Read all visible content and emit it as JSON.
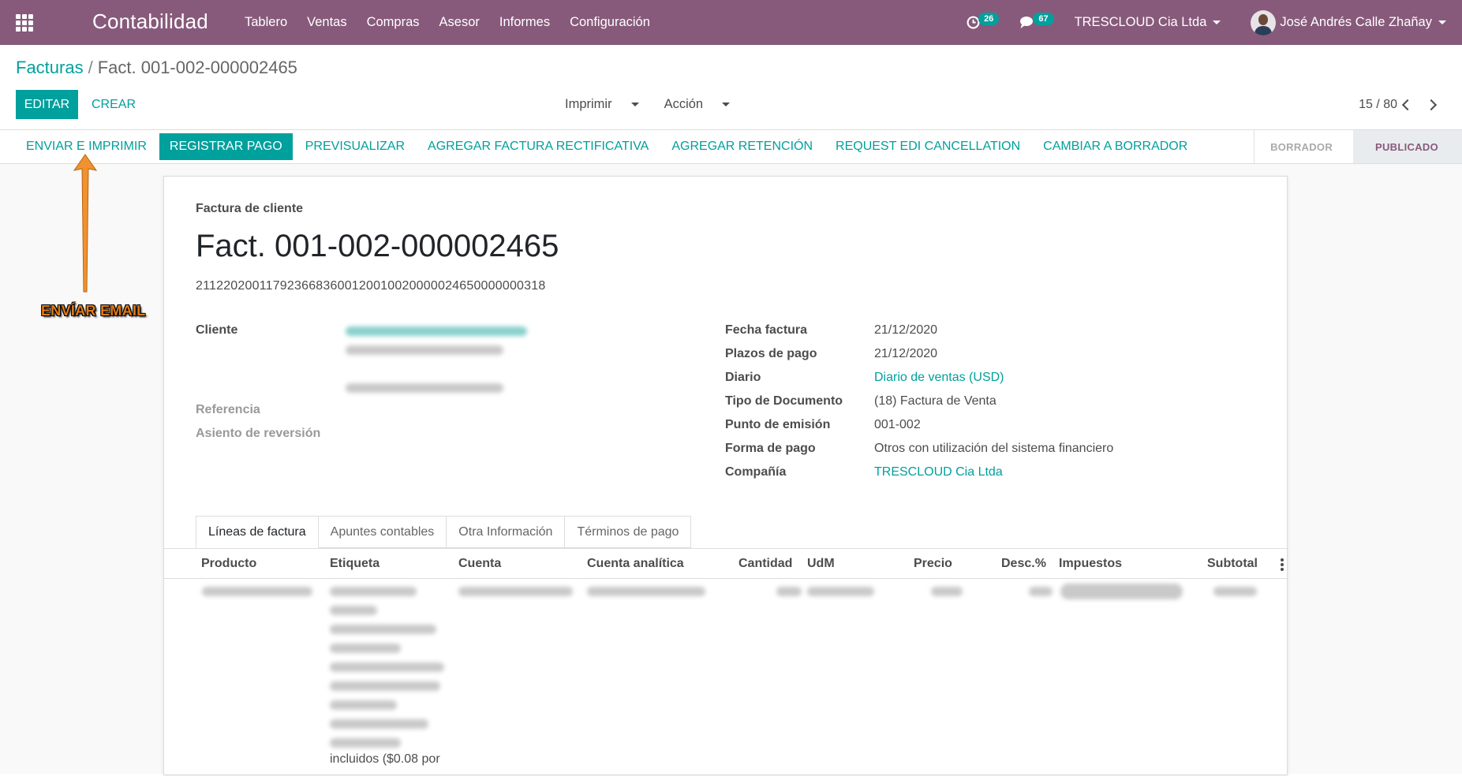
{
  "navbar": {
    "app_title": "Contabilidad",
    "menu": [
      "Tablero",
      "Ventas",
      "Compras",
      "Asesor",
      "Informes",
      "Configuración"
    ],
    "activity_count": "26",
    "messages_count": "67",
    "company": "TRESCLOUD Cia Ltda",
    "user": "José Andrés Calle Zhañay"
  },
  "control": {
    "breadcrumb_parent": "Facturas",
    "breadcrumb_separator": "/",
    "breadcrumb_current": "Fact. 001-002-000002465",
    "edit_label": "EDITAR",
    "create_label": "CREAR",
    "print_label": "Imprimir",
    "action_label": "Acción",
    "pager": "15 / 80"
  },
  "statusbar": {
    "buttons": [
      "ENVIAR E IMPRIMIR",
      "REGISTRAR PAGO",
      "PREVISUALIZAR",
      "AGREGAR FACTURA RECTIFICATIVA",
      "AGREGAR RETENCIÓN",
      "REQUEST EDI CANCELLATION",
      "CAMBIAR A BORRADOR"
    ],
    "stages": [
      "BORRADOR",
      "PUBLICADO"
    ],
    "active_stage": "PUBLICADO"
  },
  "annotation": {
    "label": "ENVÍAR EMAIL",
    "color": "#f0922e"
  },
  "form": {
    "kind": "Factura de cliente",
    "title": "Fact. 001-002-000002465",
    "access_key": "2112202001179236683600120010020000024650000000318",
    "left_fields": {
      "cliente_label": "Cliente",
      "referencia_label": "Referencia",
      "reversion_label": "Asiento de reversión"
    },
    "right_fields": [
      {
        "label": "Fecha factura",
        "value": "21/12/2020"
      },
      {
        "label": "Plazos de pago",
        "value": "21/12/2020"
      },
      {
        "label": "Diario",
        "value": "Diario de ventas (USD)"
      },
      {
        "label": "Tipo de Documento",
        "value": "(18) Factura de Venta"
      },
      {
        "label": "Punto de emisión",
        "value": "001-002"
      },
      {
        "label": "Forma de pago",
        "value": "Otros con utilización del sistema financiero"
      },
      {
        "label": "Compañía",
        "value": "TRESCLOUD Cia Ltda"
      }
    ]
  },
  "tabs": [
    "Líneas de factura",
    "Apuntes contables",
    "Otra Información",
    "Términos de pago"
  ],
  "table": {
    "columns": [
      "Producto",
      "Etiqueta",
      "Cuenta",
      "Cuenta analítica",
      "Cantidad",
      "UdM",
      "Precio",
      "Desc.%",
      "Impuestos",
      "Subtotal"
    ],
    "visible_label_fragment": "incluidos ($0.08 por"
  },
  "colors": {
    "brand": "#875a7b",
    "accent": "#00a09d"
  }
}
